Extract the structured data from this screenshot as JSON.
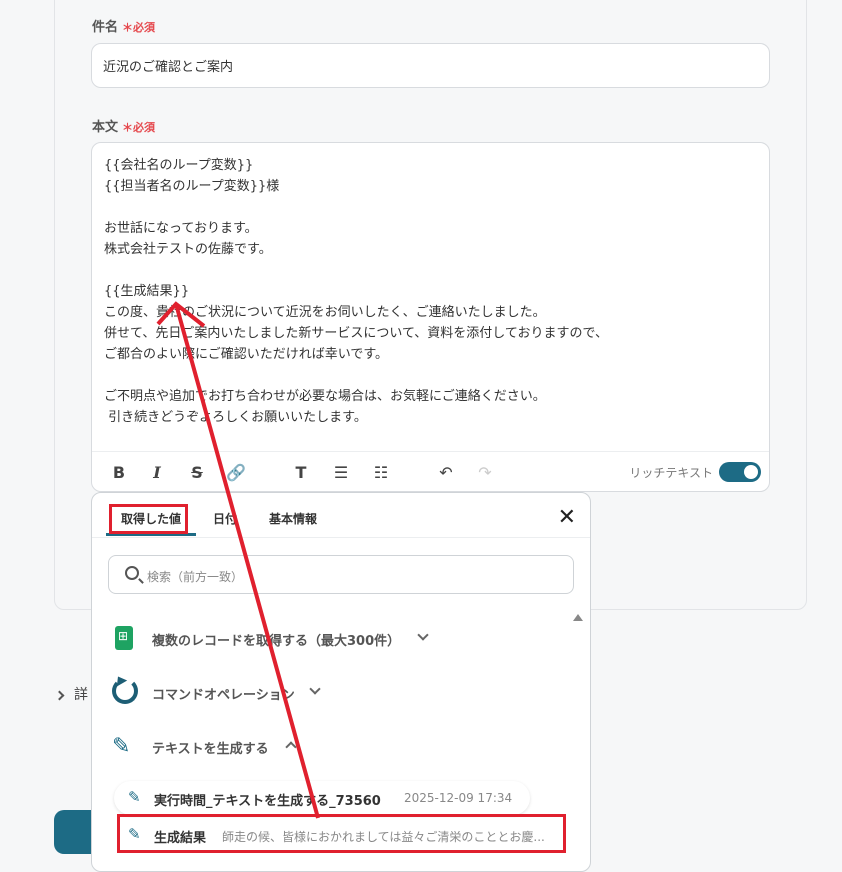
{
  "subject": {
    "label": "件名",
    "required": "＊必須",
    "value": "近況のご確認とご案内"
  },
  "body": {
    "label": "本文",
    "required": "＊必須",
    "text": "{{会社名のループ変数}}\n{{担当者名のループ変数}}様\n\nお世話になっております。\n株式会社テストの佐藤です。\n\n{{生成結果}}\nこの度、貴社のご状況について近況をお伺いしたく、ご連絡いたしました。\n併せて、先日ご案内いたしました新サービスについて、資料を添付しておりますので、\nご都合のよい際にご確認いただければ幸いです。\n\nご不明点や追加でお打ち合わせが必要な場合は、お気軽にご連絡ください。\n 引き続きどうぞよろしくお願いいたします。"
  },
  "toolbar": {
    "icons": [
      "bold-icon",
      "italic-icon",
      "strikethrough-icon",
      "link-icon",
      "text-size-icon",
      "bullet-list-icon",
      "numbered-list-icon",
      "undo-icon",
      "redo-icon"
    ],
    "rich_text_label": "リッチテキスト",
    "rich_text_enabled": true,
    "accent": "#1d6b85"
  },
  "popup": {
    "tabs": [
      "取得した値",
      "日付",
      "基本情報"
    ],
    "active_tab": "取得した値",
    "search_placeholder": "検索（前方一致）",
    "items": [
      {
        "label": "複数のレコードを取得する（最大300件）",
        "icon": "spreadsheet-icon",
        "expanded": false
      },
      {
        "label": "コマンドオペレーション",
        "icon": "command-operation-icon",
        "expanded": false
      },
      {
        "label": "テキストを生成する",
        "icon": "pen-icon",
        "expanded": true
      }
    ],
    "sub_items": [
      {
        "name": "実行時間_テキストを生成する_73560",
        "meta": "2025-12-09 17:34"
      },
      {
        "name": "生成結果",
        "meta": "師走の候、皆様におかれましては益々ご清栄のこととお慶..."
      }
    ]
  },
  "details_label": "詳",
  "annotation_color": "#e0202e"
}
